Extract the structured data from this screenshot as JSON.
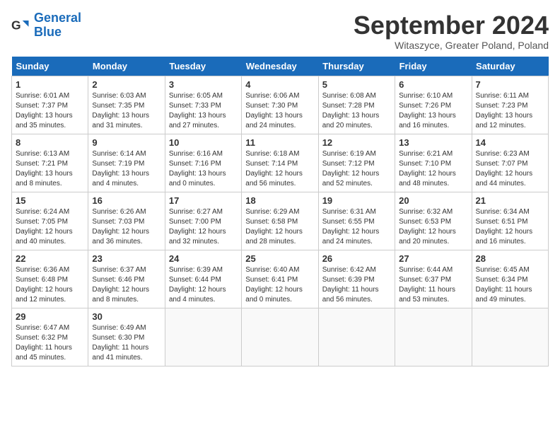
{
  "logo": {
    "line1": "General",
    "line2": "Blue"
  },
  "title": "September 2024",
  "location": "Witaszyce, Greater Poland, Poland",
  "days_of_week": [
    "Sunday",
    "Monday",
    "Tuesday",
    "Wednesday",
    "Thursday",
    "Friday",
    "Saturday"
  ],
  "weeks": [
    [
      {
        "num": "1",
        "info": "Sunrise: 6:01 AM\nSunset: 7:37 PM\nDaylight: 13 hours\nand 35 minutes."
      },
      {
        "num": "2",
        "info": "Sunrise: 6:03 AM\nSunset: 7:35 PM\nDaylight: 13 hours\nand 31 minutes."
      },
      {
        "num": "3",
        "info": "Sunrise: 6:05 AM\nSunset: 7:33 PM\nDaylight: 13 hours\nand 27 minutes."
      },
      {
        "num": "4",
        "info": "Sunrise: 6:06 AM\nSunset: 7:30 PM\nDaylight: 13 hours\nand 24 minutes."
      },
      {
        "num": "5",
        "info": "Sunrise: 6:08 AM\nSunset: 7:28 PM\nDaylight: 13 hours\nand 20 minutes."
      },
      {
        "num": "6",
        "info": "Sunrise: 6:10 AM\nSunset: 7:26 PM\nDaylight: 13 hours\nand 16 minutes."
      },
      {
        "num": "7",
        "info": "Sunrise: 6:11 AM\nSunset: 7:23 PM\nDaylight: 13 hours\nand 12 minutes."
      }
    ],
    [
      {
        "num": "8",
        "info": "Sunrise: 6:13 AM\nSunset: 7:21 PM\nDaylight: 13 hours\nand 8 minutes."
      },
      {
        "num": "9",
        "info": "Sunrise: 6:14 AM\nSunset: 7:19 PM\nDaylight: 13 hours\nand 4 minutes."
      },
      {
        "num": "10",
        "info": "Sunrise: 6:16 AM\nSunset: 7:16 PM\nDaylight: 13 hours\nand 0 minutes."
      },
      {
        "num": "11",
        "info": "Sunrise: 6:18 AM\nSunset: 7:14 PM\nDaylight: 12 hours\nand 56 minutes."
      },
      {
        "num": "12",
        "info": "Sunrise: 6:19 AM\nSunset: 7:12 PM\nDaylight: 12 hours\nand 52 minutes."
      },
      {
        "num": "13",
        "info": "Sunrise: 6:21 AM\nSunset: 7:10 PM\nDaylight: 12 hours\nand 48 minutes."
      },
      {
        "num": "14",
        "info": "Sunrise: 6:23 AM\nSunset: 7:07 PM\nDaylight: 12 hours\nand 44 minutes."
      }
    ],
    [
      {
        "num": "15",
        "info": "Sunrise: 6:24 AM\nSunset: 7:05 PM\nDaylight: 12 hours\nand 40 minutes."
      },
      {
        "num": "16",
        "info": "Sunrise: 6:26 AM\nSunset: 7:03 PM\nDaylight: 12 hours\nand 36 minutes."
      },
      {
        "num": "17",
        "info": "Sunrise: 6:27 AM\nSunset: 7:00 PM\nDaylight: 12 hours\nand 32 minutes."
      },
      {
        "num": "18",
        "info": "Sunrise: 6:29 AM\nSunset: 6:58 PM\nDaylight: 12 hours\nand 28 minutes."
      },
      {
        "num": "19",
        "info": "Sunrise: 6:31 AM\nSunset: 6:55 PM\nDaylight: 12 hours\nand 24 minutes."
      },
      {
        "num": "20",
        "info": "Sunrise: 6:32 AM\nSunset: 6:53 PM\nDaylight: 12 hours\nand 20 minutes."
      },
      {
        "num": "21",
        "info": "Sunrise: 6:34 AM\nSunset: 6:51 PM\nDaylight: 12 hours\nand 16 minutes."
      }
    ],
    [
      {
        "num": "22",
        "info": "Sunrise: 6:36 AM\nSunset: 6:48 PM\nDaylight: 12 hours\nand 12 minutes."
      },
      {
        "num": "23",
        "info": "Sunrise: 6:37 AM\nSunset: 6:46 PM\nDaylight: 12 hours\nand 8 minutes."
      },
      {
        "num": "24",
        "info": "Sunrise: 6:39 AM\nSunset: 6:44 PM\nDaylight: 12 hours\nand 4 minutes."
      },
      {
        "num": "25",
        "info": "Sunrise: 6:40 AM\nSunset: 6:41 PM\nDaylight: 12 hours\nand 0 minutes."
      },
      {
        "num": "26",
        "info": "Sunrise: 6:42 AM\nSunset: 6:39 PM\nDaylight: 11 hours\nand 56 minutes."
      },
      {
        "num": "27",
        "info": "Sunrise: 6:44 AM\nSunset: 6:37 PM\nDaylight: 11 hours\nand 53 minutes."
      },
      {
        "num": "28",
        "info": "Sunrise: 6:45 AM\nSunset: 6:34 PM\nDaylight: 11 hours\nand 49 minutes."
      }
    ],
    [
      {
        "num": "29",
        "info": "Sunrise: 6:47 AM\nSunset: 6:32 PM\nDaylight: 11 hours\nand 45 minutes."
      },
      {
        "num": "30",
        "info": "Sunrise: 6:49 AM\nSunset: 6:30 PM\nDaylight: 11 hours\nand 41 minutes."
      },
      {
        "num": "",
        "info": ""
      },
      {
        "num": "",
        "info": ""
      },
      {
        "num": "",
        "info": ""
      },
      {
        "num": "",
        "info": ""
      },
      {
        "num": "",
        "info": ""
      }
    ]
  ]
}
